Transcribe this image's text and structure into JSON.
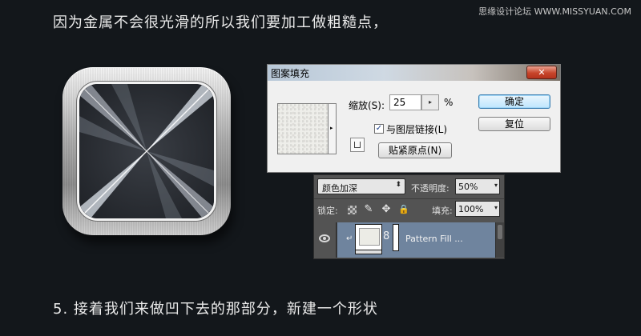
{
  "page": {
    "heading": "因为金属不会很光滑的所以我们要加工做粗糙点，",
    "footer": "5. 接着我们来做凹下去的那部分，新建一个形状",
    "watermark": "思缘设计论坛 WWW.MISSYUAN.COM"
  },
  "icon": {
    "name": "metal-icon-preview"
  },
  "dialog": {
    "title": "图案填充",
    "close_glyph": "✕",
    "scale_label": "缩放(S):",
    "scale_value": "25",
    "scale_stepper": "▸",
    "scale_unit": "%",
    "link_checked": true,
    "link_check_glyph": "✓",
    "link_label": "与图层链接(L)",
    "snap_origin_label": "贴紧原点(N)",
    "ok_label": "确定",
    "reset_label": "复位",
    "pattern_dropdown_glyph": "▸"
  },
  "layers_panel": {
    "blend_mode": "颜色加深",
    "blend_arrow": "⬍",
    "opacity_label": "不透明度:",
    "opacity_value": "50%",
    "fill_label": "填充:",
    "fill_value": "100%",
    "spin_arrow": "▾",
    "lock_label": "锁定:",
    "lock_icons": [
      "lock-transparent-icon",
      "brush-icon",
      "move-icon",
      "lock-icon"
    ],
    "brush_glyph": "✎",
    "move_glyph": "✥",
    "lock_glyph": "🔒",
    "clip_glyph": "↵",
    "chain_glyph": "8",
    "layer": {
      "name": "Pattern Fill ...",
      "visible": true
    }
  }
}
